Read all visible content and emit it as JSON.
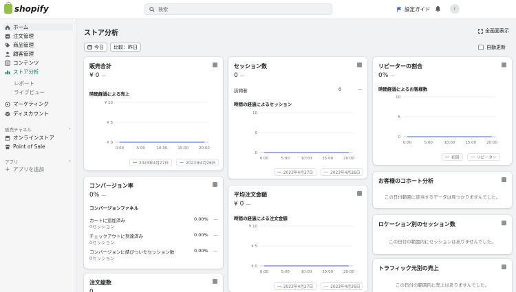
{
  "topbar": {
    "logo_text": "shopify",
    "search_placeholder": "検索",
    "guide_label": "設定ガイド",
    "avatar_letter": "t"
  },
  "sidebar": {
    "items": [
      {
        "label": "ホーム",
        "icon": "home-icon"
      },
      {
        "label": "注文管理",
        "icon": "order-icon"
      },
      {
        "label": "商品管理",
        "icon": "tag-icon"
      },
      {
        "label": "顧客管理",
        "icon": "person-icon"
      },
      {
        "label": "コンテンツ",
        "icon": "content-icon"
      },
      {
        "label": "ストア分析",
        "icon": "analytics-icon"
      }
    ],
    "subitems": [
      "レポート",
      "ライブビュー"
    ],
    "items2": [
      {
        "label": "マーケティング",
        "icon": "target-icon"
      },
      {
        "label": "ディスカウント",
        "icon": "discount-icon"
      }
    ],
    "sales_channels_label": "販売チャネル",
    "channels": [
      {
        "label": "オンラインストア",
        "icon": "store-icon"
      },
      {
        "label": "Point of Sale",
        "icon": "pos-icon"
      }
    ],
    "apps_label": "アプリ",
    "add_app_label": "アプリを追加"
  },
  "main": {
    "title": "ストア分析",
    "fullscreen_label": "全画面表示",
    "date_button": "今日",
    "compare_button": "比較：昨日",
    "auto_update_label": "自動更新"
  },
  "colors": {
    "accent": "#008060",
    "series_current": "#8c9fe8",
    "series_previous": "#b5b8bc"
  },
  "cards": {
    "sales": {
      "title": "販売合計",
      "value": "¥ 0",
      "dash": "—",
      "chart_title": "時間経過による売上",
      "legend_current": "2023年4月27日",
      "legend_previous": "2023年4月26日"
    },
    "sessions": {
      "title": "セッション数",
      "value": "0",
      "dash": "—",
      "visitors_label": "訪問者",
      "visitors_value": "0",
      "visitors_dash": "—",
      "chart_title": "時間の経過によるセッション",
      "legend_current": "2023年4月27日",
      "legend_previous": "2023年4月26日"
    },
    "repeat": {
      "title": "リピーターの割合",
      "value": "0%",
      "dash": "—",
      "chart_title": "時間経過によるお客様数",
      "legend_current": "初回",
      "legend_previous": "リピーター"
    },
    "conversion": {
      "title": "コンバージョン率",
      "value": "0%",
      "dash": "—",
      "funnel_title": "コンバージョンファネル",
      "rows": [
        {
          "label": "カートに追加済み",
          "sub": "0セッション",
          "pct": "0.00%",
          "dash": "—"
        },
        {
          "label": "チェックアウトに到達済み",
          "sub": "0セッション",
          "pct": "0.00%",
          "dash": "—"
        },
        {
          "label": "コンバージョンに結びついたセッション数",
          "sub": "0セッション",
          "pct": "0.00%",
          "dash": "—"
        }
      ]
    },
    "aov": {
      "title": "平均注文金額",
      "value": "¥ 0",
      "dash": "—",
      "chart_title": "時間の経過による注文金額",
      "legend_current": "2023年4月27日",
      "legend_previous": "2023年4月26日"
    },
    "cohort": {
      "title": "お客様のコホート分析",
      "message": "この日付範囲に該当するデータは見つかりませんでした。"
    },
    "location": {
      "title": "ロケーション別のセッション数",
      "message": "この日付の範囲内にセッションはありませんでした。"
    },
    "traffic": {
      "title": "トラフィック元別の売上",
      "message": "この日付の範囲内に売上はありませんでした。"
    },
    "orders": {
      "title": "注文総数",
      "value": "0"
    }
  },
  "chart_data": [
    {
      "type": "line",
      "title": "時間経過による売上",
      "x": [
        "0:00",
        "5:00",
        "10:00",
        "15:00",
        "20:00"
      ],
      "yticks": [
        "¥ 0",
        "¥ 5",
        "¥ 10"
      ],
      "ylim": [
        0,
        10
      ],
      "series": [
        {
          "name": "2023年4月27日",
          "values": [
            0,
            0,
            0,
            0,
            0
          ]
        },
        {
          "name": "2023年4月26日",
          "values": [
            0,
            0,
            0,
            0,
            0
          ]
        }
      ]
    },
    {
      "type": "line",
      "title": "時間の経過によるセッション",
      "x": [
        "0:00",
        "5:00",
        "10:00",
        "15:00",
        "20:00"
      ],
      "yticks": [
        "0",
        "5",
        "10"
      ],
      "ylim": [
        0,
        10
      ],
      "series": [
        {
          "name": "2023年4月27日",
          "values": [
            0,
            0,
            0,
            0,
            0
          ]
        },
        {
          "name": "2023年4月26日",
          "values": [
            0,
            0,
            0,
            0,
            0
          ]
        }
      ]
    },
    {
      "type": "line",
      "title": "時間経過によるお客様数",
      "x": [
        "0:00",
        "5:00",
        "10:00",
        "15:00",
        "20:00"
      ],
      "yticks": [
        "0",
        "5",
        "10"
      ],
      "ylim": [
        0,
        10
      ],
      "series": [
        {
          "name": "初回",
          "values": [
            0,
            0,
            0,
            0,
            0
          ]
        },
        {
          "name": "リピーター",
          "values": [
            0,
            0,
            0,
            0,
            0
          ]
        }
      ]
    },
    {
      "type": "line",
      "title": "時間の経過による注文金額",
      "x": [
        "0:00",
        "5:00",
        "10:00",
        "15:00",
        "20:00"
      ],
      "yticks": [
        "¥ 0",
        "¥ 5",
        "¥ 10"
      ],
      "ylim": [
        0,
        10
      ],
      "series": [
        {
          "name": "2023年4月27日",
          "values": [
            0,
            0,
            0,
            0,
            0
          ]
        },
        {
          "name": "2023年4月26日",
          "values": [
            0,
            0,
            0,
            0,
            0
          ]
        }
      ]
    }
  ]
}
